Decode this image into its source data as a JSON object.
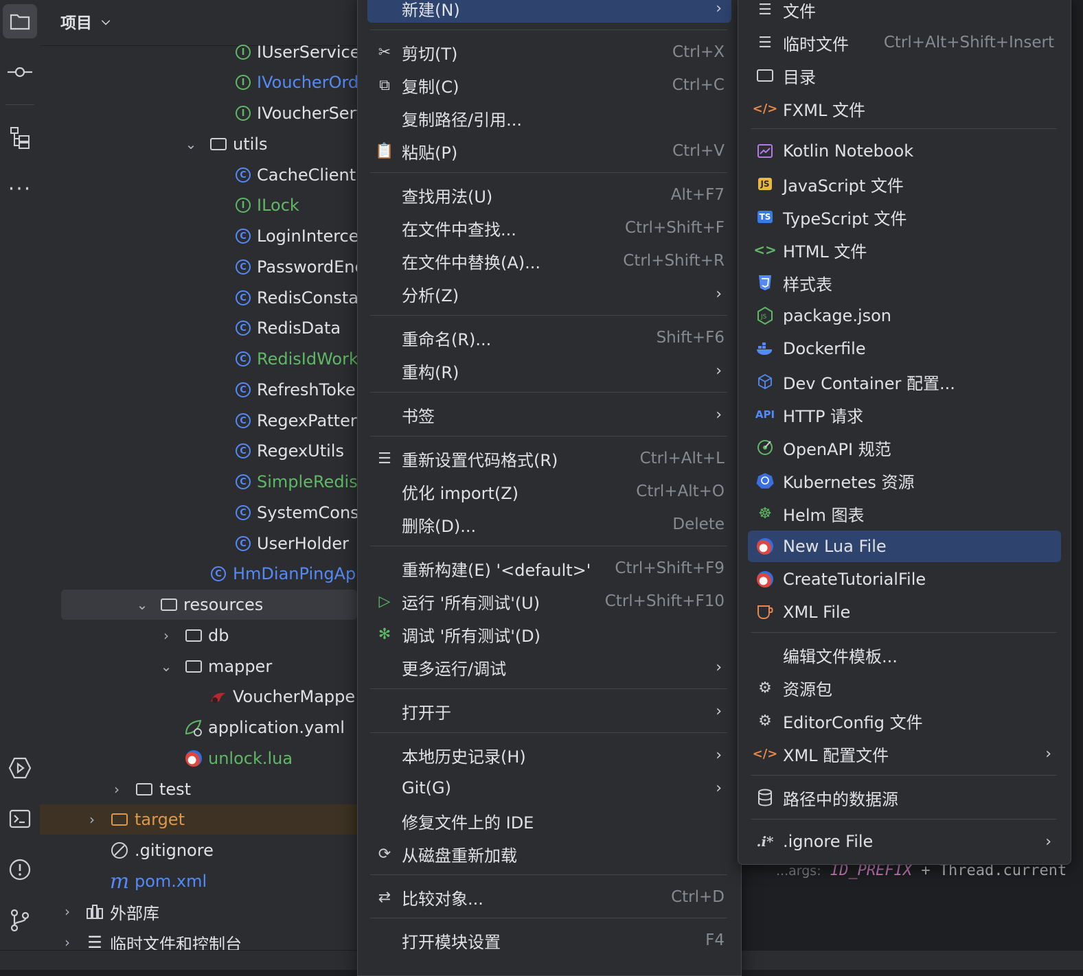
{
  "project_panel": {
    "title": "项目",
    "rows": [
      {
        "label": "IUserService",
        "kind": "interface",
        "color": "normal"
      },
      {
        "label": "IVoucherOrd",
        "kind": "interface",
        "color": "blue"
      },
      {
        "label": "IVoucherServ",
        "kind": "interface",
        "color": "normal"
      },
      {
        "label": "utils",
        "kind": "package",
        "color": "normal"
      },
      {
        "label": "CacheClient",
        "kind": "class",
        "color": "normal"
      },
      {
        "label": "ILock",
        "kind": "interface",
        "color": "green"
      },
      {
        "label": "LoginInterce",
        "kind": "class",
        "color": "normal"
      },
      {
        "label": "PasswordEnc",
        "kind": "class",
        "color": "normal"
      },
      {
        "label": "RedisConsta",
        "kind": "class",
        "color": "normal"
      },
      {
        "label": "RedisData",
        "kind": "class",
        "color": "normal"
      },
      {
        "label": "RedisIdWork",
        "kind": "class",
        "color": "green"
      },
      {
        "label": "RefreshToke",
        "kind": "class",
        "color": "normal"
      },
      {
        "label": "RegexPatter",
        "kind": "class",
        "color": "normal"
      },
      {
        "label": "RegexUtils",
        "kind": "class",
        "color": "normal"
      },
      {
        "label": "SimpleRedisl",
        "kind": "class",
        "color": "green"
      },
      {
        "label": "SystemConst",
        "kind": "class",
        "color": "normal"
      },
      {
        "label": "UserHolder",
        "kind": "class",
        "color": "normal"
      },
      {
        "label": "HmDianPingAp",
        "kind": "spring-app",
        "color": "blue"
      },
      {
        "label": "resources",
        "kind": "folder",
        "color": "normal"
      },
      {
        "label": "db",
        "kind": "folder",
        "color": "normal"
      },
      {
        "label": "mapper",
        "kind": "folder",
        "color": "normal"
      },
      {
        "label": "VoucherMappe",
        "kind": "mybatis",
        "color": "normal"
      },
      {
        "label": "application.yaml",
        "kind": "yaml",
        "color": "normal"
      },
      {
        "label": "unlock.lua",
        "kind": "lua",
        "color": "green"
      },
      {
        "label": "test",
        "kind": "folder",
        "color": "normal"
      },
      {
        "label": "target",
        "kind": "folder",
        "color": "orange"
      },
      {
        "label": ".gitignore",
        "kind": "ignore",
        "color": "normal"
      },
      {
        "label": "pom.xml",
        "kind": "maven",
        "color": "blue"
      },
      {
        "label": "外部库",
        "kind": "library",
        "color": "normal"
      },
      {
        "label": "临时文件和控制台",
        "kind": "scratch",
        "color": "normal"
      }
    ]
  },
  "context_menu": {
    "items": [
      {
        "label": "新建(N)",
        "shortcut": "",
        "submenu": true,
        "icon": ""
      },
      {
        "label": "剪切(T)",
        "shortcut": "Ctrl+X",
        "icon": "scissors-icon"
      },
      {
        "label": "复制(C)",
        "shortcut": "Ctrl+C",
        "icon": "copy-icon"
      },
      {
        "label": "复制路径/引用...",
        "shortcut": "",
        "icon": ""
      },
      {
        "label": "粘贴(P)",
        "shortcut": "Ctrl+V",
        "icon": "paste-icon"
      },
      {
        "label": "查找用法(U)",
        "shortcut": "Alt+F7",
        "icon": ""
      },
      {
        "label": "在文件中查找...",
        "shortcut": "Ctrl+Shift+F",
        "icon": ""
      },
      {
        "label": "在文件中替换(A)...",
        "shortcut": "Ctrl+Shift+R",
        "icon": ""
      },
      {
        "label": "分析(Z)",
        "shortcut": "",
        "submenu": true,
        "icon": ""
      },
      {
        "label": "重命名(R)...",
        "shortcut": "Shift+F6",
        "icon": ""
      },
      {
        "label": "重构(R)",
        "shortcut": "",
        "submenu": true,
        "icon": ""
      },
      {
        "label": "书签",
        "shortcut": "",
        "submenu": true,
        "icon": ""
      },
      {
        "label": "重新设置代码格式(R)",
        "shortcut": "Ctrl+Alt+L",
        "icon": "reformat-icon"
      },
      {
        "label": "优化 import(Z)",
        "shortcut": "Ctrl+Alt+O",
        "icon": ""
      },
      {
        "label": "删除(D)...",
        "shortcut": "Delete",
        "icon": ""
      },
      {
        "label": "重新构建(E) '<default>'",
        "shortcut": "Ctrl+Shift+F9",
        "icon": ""
      },
      {
        "label": "运行 '所有测试'(U)",
        "shortcut": "Ctrl+Shift+F10",
        "icon": "run-icon"
      },
      {
        "label": "调试 '所有测试'(D)",
        "shortcut": "",
        "icon": "debug-icon"
      },
      {
        "label": "更多运行/调试",
        "shortcut": "",
        "submenu": true,
        "icon": ""
      },
      {
        "label": "打开于",
        "shortcut": "",
        "submenu": true,
        "icon": ""
      },
      {
        "label": "本地历史记录(H)",
        "shortcut": "",
        "submenu": true,
        "icon": ""
      },
      {
        "label": "Git(G)",
        "shortcut": "",
        "submenu": true,
        "icon": ""
      },
      {
        "label": "修复文件上的 IDE",
        "shortcut": "",
        "icon": ""
      },
      {
        "label": "从磁盘重新加载",
        "shortcut": "",
        "icon": "reload-icon"
      },
      {
        "label": "比较对象...",
        "shortcut": "Ctrl+D",
        "icon": "compare-icon"
      },
      {
        "label": "打开模块设置",
        "shortcut": "F4",
        "icon": ""
      }
    ]
  },
  "new_submenu": {
    "items": [
      {
        "label": "文件",
        "shortcut": "",
        "icon": "file-icon"
      },
      {
        "label": "临时文件",
        "shortcut": "Ctrl+Alt+Shift+Insert",
        "icon": "scratch-file-icon"
      },
      {
        "label": "目录",
        "shortcut": "",
        "icon": "folder-icon"
      },
      {
        "label": "FXML 文件",
        "shortcut": "",
        "icon": "fxml-icon"
      },
      {
        "label": "Kotlin Notebook",
        "shortcut": "",
        "icon": "kotlin-notebook-icon"
      },
      {
        "label": "JavaScript 文件",
        "shortcut": "",
        "icon": "javascript-icon"
      },
      {
        "label": "TypeScript 文件",
        "shortcut": "",
        "icon": "typescript-icon"
      },
      {
        "label": "HTML 文件",
        "shortcut": "",
        "icon": "html-icon"
      },
      {
        "label": "样式表",
        "shortcut": "",
        "icon": "css-icon"
      },
      {
        "label": "package.json",
        "shortcut": "",
        "icon": "nodejs-icon"
      },
      {
        "label": "Dockerfile",
        "shortcut": "",
        "icon": "docker-icon"
      },
      {
        "label": "Dev Container 配置...",
        "shortcut": "",
        "icon": "dev-container-icon"
      },
      {
        "label": "HTTP 请求",
        "shortcut": "",
        "icon": "api-icon"
      },
      {
        "label": "OpenAPI 规范",
        "shortcut": "",
        "icon": "openapi-icon"
      },
      {
        "label": "Kubernetes 资源",
        "shortcut": "",
        "icon": "kubernetes-icon"
      },
      {
        "label": "Helm 图表",
        "shortcut": "",
        "icon": "helm-icon"
      },
      {
        "label": "New Lua File",
        "shortcut": "",
        "icon": "lua-icon"
      },
      {
        "label": "CreateTutorialFile",
        "shortcut": "",
        "icon": "lua-icon"
      },
      {
        "label": "XML File",
        "shortcut": "",
        "icon": "xml-file-icon"
      },
      {
        "label": "编辑文件模板...",
        "shortcut": "",
        "icon": ""
      },
      {
        "label": "资源包",
        "shortcut": "",
        "icon": "gear-icon"
      },
      {
        "label": "EditorConfig 文件",
        "shortcut": "",
        "icon": "gear-icon"
      },
      {
        "label": "XML 配置文件",
        "shortcut": "",
        "icon": "xml-config-icon",
        "submenu": true
      },
      {
        "label": "路径中的数据源",
        "shortcut": "",
        "icon": "database-icon"
      },
      {
        "label": ".ignore File",
        "shortcut": "",
        "icon": "ignore-icon",
        "submenu": true
      }
    ]
  },
  "editor": {
    "hint": "...args:",
    "const": "ID_PREFIX",
    "rest": " + Thread.current"
  },
  "colors": {
    "highlight": "#2e436e",
    "panel": "#2b2d30",
    "green": "#5fb865",
    "blue": "#548af7"
  }
}
